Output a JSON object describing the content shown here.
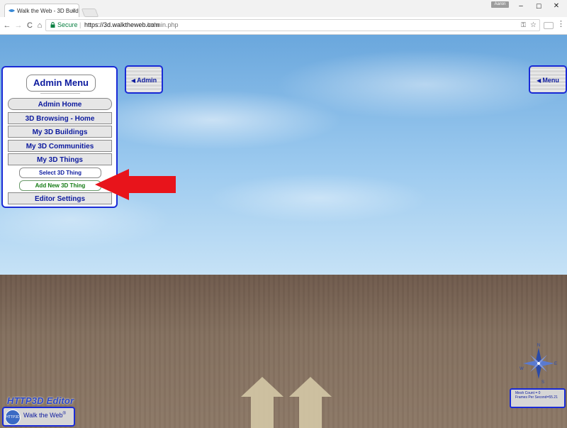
{
  "browser": {
    "tab_title": "Walk the Web - 3D Buildi",
    "tab_close": "×",
    "user_badge": "Aaron",
    "window_buttons": {
      "minimize": "–",
      "maximize": "☐",
      "close": "✕"
    },
    "nav": {
      "back": "←",
      "forward": "→",
      "reload": "C",
      "home": "⌂"
    },
    "secure_label": "Secure",
    "url_separator": "|",
    "url_host": "https://3d.walktheweb.com",
    "url_path": "/admin.php",
    "key_icon": "⚿",
    "star_icon": "☆",
    "menu_icon": "⋮"
  },
  "admin_menu": {
    "title": "Admin Menu",
    "items": [
      {
        "label": "Admin Home"
      },
      {
        "label": "3D Browsing - Home"
      },
      {
        "label": "My 3D Buildings"
      },
      {
        "label": "My 3D Communities"
      },
      {
        "label": "My 3D Things"
      }
    ],
    "sub_items": [
      {
        "label": "Select 3D Thing"
      },
      {
        "label": "Add New 3D Thing"
      }
    ],
    "settings_label": "Editor Settings"
  },
  "side_tabs": {
    "admin_label": "Admin",
    "menu_label": "Menu",
    "arrow_glyph": "◀"
  },
  "hud": {
    "editor_title": "HTTP3D Editor",
    "wtw_label": "Walk the Web",
    "wtw_mark": "®",
    "logo_text": "HTTP3D",
    "stats_mesh": "Mesh Count = 0",
    "stats_fps": "Frames Per Second=55.21",
    "compass_letters": {
      "north": "N",
      "east": "E",
      "south": "S",
      "west": "W"
    }
  },
  "colors": {
    "accent_blue": "#1a2bd6",
    "label_blue": "#0c1a9e",
    "active_green": "#127a12",
    "arrow_red": "#e8141b",
    "sky_blue": "#9ccaef",
    "ground_brown": "#84705f"
  },
  "icons": [
    "lock-icon",
    "favicon-icon",
    "compass-icon",
    "move-arrows-icon",
    "red-pointer-arrow-icon"
  ]
}
